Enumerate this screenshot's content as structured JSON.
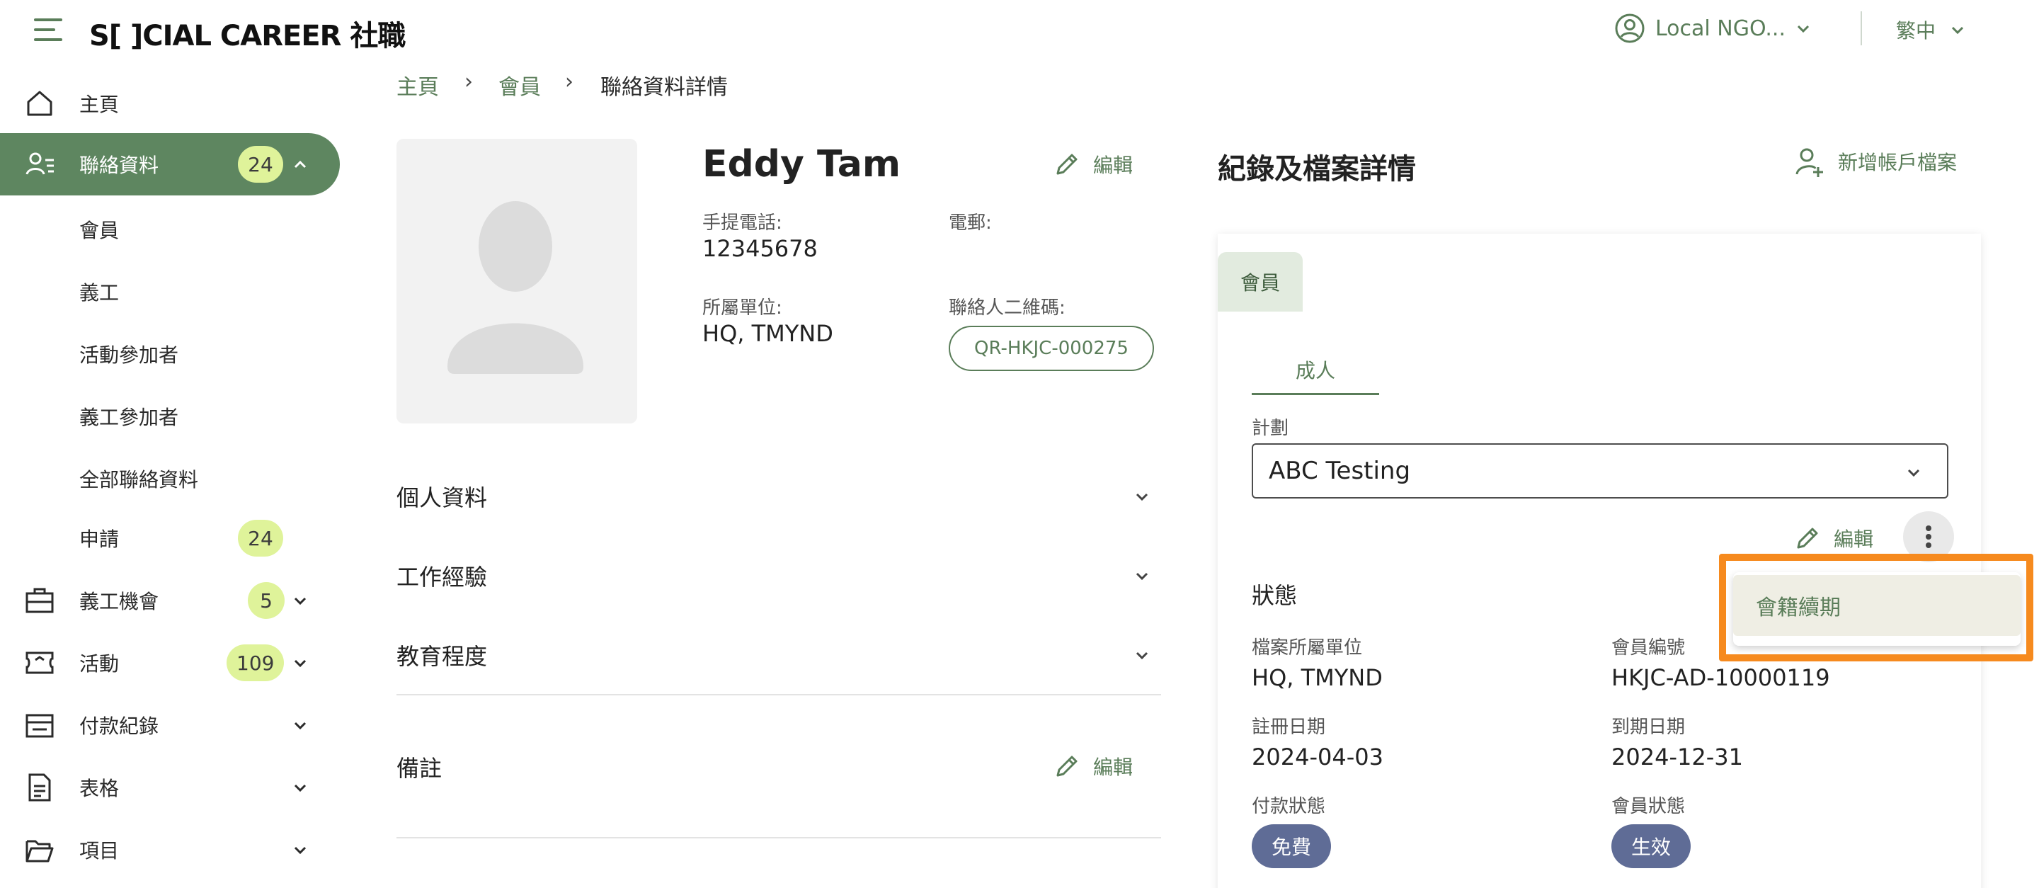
{
  "app": {
    "logo_text": "S[ ]CIAL CAREER 社職",
    "account_name": "Local NGO...",
    "language": "繁中"
  },
  "sidebar": {
    "home": "主頁",
    "contacts": {
      "label": "聯絡資料",
      "badge": "24"
    },
    "contact_sub": [
      "會員",
      "義工",
      "活動參加者",
      "義工參加者",
      "全部聯絡資料"
    ],
    "applications": {
      "label": "申請",
      "badge": "24"
    },
    "volunteer_ops": {
      "label": "義工機會",
      "badge": "5"
    },
    "events": {
      "label": "活動",
      "badge": "109"
    },
    "payments": {
      "label": "付款紀錄"
    },
    "forms": {
      "label": "表格"
    },
    "projects": {
      "label": "項目"
    }
  },
  "breadcrumb": {
    "home": "主頁",
    "members": "會員",
    "current": "聯絡資料詳情"
  },
  "profile": {
    "name": "Eddy Tam",
    "edit_label": "編輯",
    "mobile_label": "手提電話:",
    "mobile_value": "12345678",
    "email_label": "電郵:",
    "unit_label": "所屬單位:",
    "unit_value": "HQ, TMYND",
    "qr_label": "聯絡人二維碼:",
    "qr_value": "QR-HKJC-000275"
  },
  "sections": {
    "personal": "個人資料",
    "work": "工作經驗",
    "education": "教育程度",
    "remarks": "備註",
    "remarks_edit": "編輯"
  },
  "records": {
    "title": "紀錄及檔案詳情",
    "add_account": "新增帳戶檔案",
    "tab_member": "會員",
    "subtab_adult": "成人",
    "plan_label": "計劃",
    "plan_value": "ABC Testing",
    "edit_label": "編輯",
    "status_heading": "狀態",
    "unit_label": "檔案所屬單位",
    "unit_value": "HQ, TMYND",
    "member_no_label": "會員編號",
    "member_no_value": "HKJC-AD-10000119",
    "reg_date_label": "註冊日期",
    "reg_date_value": "2024-04-03",
    "expiry_label": "到期日期",
    "expiry_value": "2024-12-31",
    "payment_status_label": "付款狀態",
    "payment_status_value": "免費",
    "member_status_label": "會員狀態",
    "member_status_value": "生效"
  },
  "context_menu": {
    "renew": "會籍續期"
  },
  "colors": {
    "brand_green": "#5e8660",
    "badge_lime": "#dff39a",
    "status_pill": "#5f6c96",
    "highlight_orange": "#f68a1e"
  }
}
